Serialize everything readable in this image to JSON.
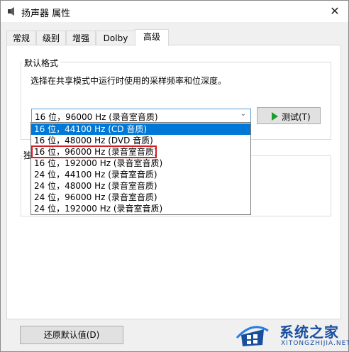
{
  "window": {
    "title": "扬声器 属性",
    "close_glyph": "✕"
  },
  "tabs": [
    {
      "label": "常规",
      "active": false
    },
    {
      "label": "级别",
      "active": false
    },
    {
      "label": "增强",
      "active": false
    },
    {
      "label": "Dolby",
      "active": false
    },
    {
      "label": "高级",
      "active": true
    }
  ],
  "default_format": {
    "group_label": "默认格式",
    "description": "选择在共享模式中运行时使用的采样频率和位深度。",
    "selected_value": "16 位，96000 Hz (录音室音质)",
    "test_button_label": "测试(T)",
    "options": [
      {
        "label": "16 位，44100 Hz (CD 音质)",
        "highlighted": true
      },
      {
        "label": "16 位，48000 Hz (DVD 音质)",
        "highlighted": false
      },
      {
        "label": "16 位，96000 Hz (录音室音质)",
        "highlighted": false
      },
      {
        "label": "16 位，192000 Hz (录音室音质)",
        "highlighted": false
      },
      {
        "label": "24 位，44100 Hz (录音室音质)",
        "highlighted": false
      },
      {
        "label": "24 位，48000 Hz (录音室音质)",
        "highlighted": false
      },
      {
        "label": "24 位，96000 Hz (录音室音质)",
        "highlighted": false
      },
      {
        "label": "24 位，192000 Hz (录音室音质)",
        "highlighted": false
      }
    ]
  },
  "exclusive_mode": {
    "group_label_partial": "独"
  },
  "footer": {
    "reset_button_label": "还原默认值(D)"
  },
  "watermark": {
    "name": "系统之家",
    "url": "XITONGZHIJIA.NET"
  },
  "colors": {
    "selection": "#0078d7",
    "annotation_red": "#d2202a",
    "play_green": "#1a9d2a",
    "brand_blue": "#1a4fa0"
  },
  "icons": {
    "window_icon": "speaker-icon",
    "test_icon": "play-icon",
    "close_icon": "close-icon"
  }
}
